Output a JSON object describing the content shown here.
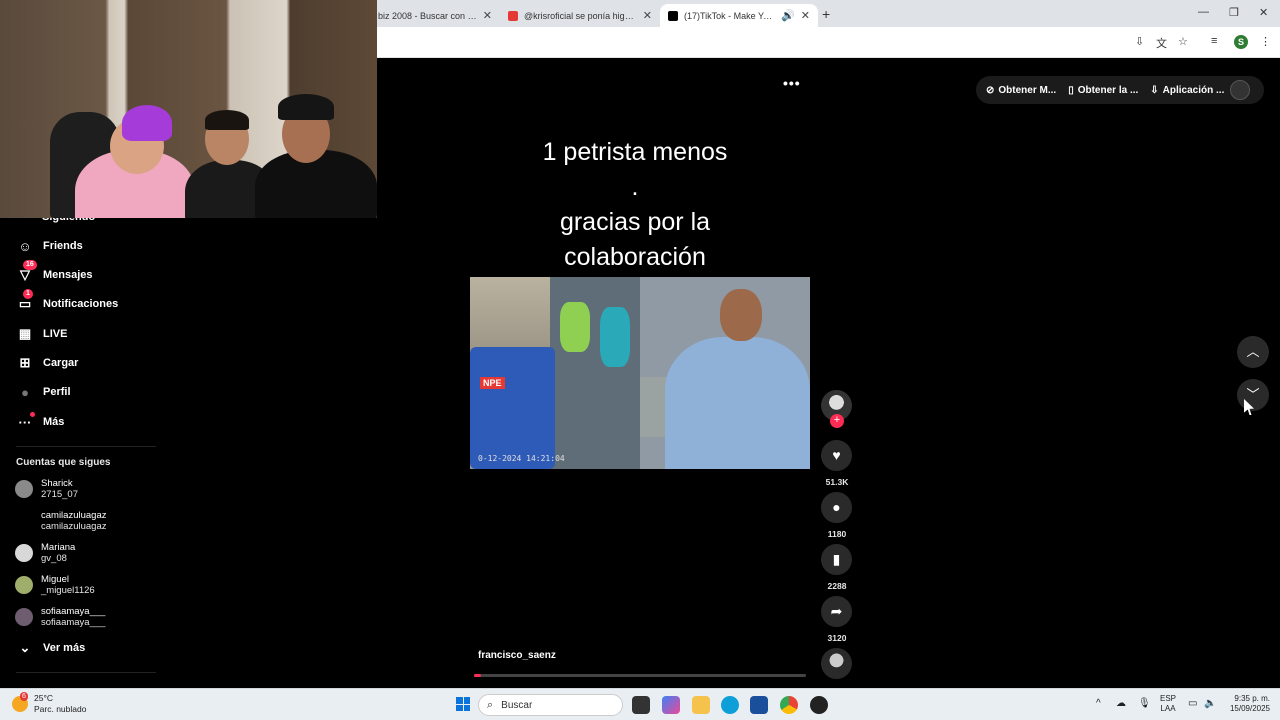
{
  "browser": {
    "tabs": [
      {
        "title": "biz 2008 - Buscar con Goo",
        "favicon_color": "#4285f4"
      },
      {
        "title": "@krisroficial se ponía high en e",
        "favicon_color": "#e53935"
      },
      {
        "title": "(17)TikTok - Make Your Day",
        "favicon_color": "#000000",
        "active": true
      }
    ],
    "new_tab": "+",
    "profile_initial": "S"
  },
  "sidebar": {
    "partial_item": "Siguiendo",
    "items": [
      {
        "label": "Friends",
        "icon": "friends-icon",
        "glyph": "☺"
      },
      {
        "label": "Mensajes",
        "icon": "messages-icon",
        "glyph": "✈",
        "badge": "16"
      },
      {
        "label": "Notificaciones",
        "icon": "notifications-icon",
        "glyph": "✉",
        "badge": "1"
      },
      {
        "label": "LIVE",
        "icon": "live-icon",
        "glyph": "▣"
      },
      {
        "label": "Cargar",
        "icon": "upload-icon",
        "glyph": "⊞"
      },
      {
        "label": "Perfil",
        "icon": "profile-icon",
        "glyph": "●"
      },
      {
        "label": "Más",
        "icon": "more-icon",
        "glyph": "···"
      }
    ],
    "following_title": "Cuentas que sigues",
    "following": [
      {
        "name": "Sharick",
        "username": "2715_07",
        "avatar_color": "#8a8a8a"
      },
      {
        "name": "camilazuluagaz",
        "username": "camilazuluagaz",
        "avatar_color": "#000000"
      },
      {
        "name": "Mariana",
        "username": "gv_08",
        "avatar_color": "#d8d8d8"
      },
      {
        "name": "Miguel",
        "username": "_miguel1126",
        "avatar_color": "#9fae6b"
      },
      {
        "name": "sofiaamaya___",
        "username": "sofiaamaya___",
        "avatar_color": "#6d5d6e"
      }
    ],
    "see_more": "Ver más"
  },
  "video": {
    "caption_lines": [
      "1 petrista menos",
      ".",
      "gracias por la",
      "colaboración"
    ],
    "overlay_logo": "NPE",
    "timestamp": "0-12-2024 14:21:04",
    "author": "francisco_saenz",
    "progress": 0.01
  },
  "actions": {
    "likes": "51.3K",
    "comments": "1180",
    "saves": "2288",
    "shares": "3120"
  },
  "top_pill": {
    "items": [
      "Obtener M...",
      "Obtener la ...",
      "Aplicación ..."
    ]
  },
  "taskbar": {
    "temperature": "25°C",
    "weather": "Parc. nublado",
    "weather_badge": "6",
    "search_placeholder": "Buscar",
    "language": "ESP",
    "layout": "LAA",
    "time": "9:35 p. m.",
    "date": "15/09/2025"
  }
}
